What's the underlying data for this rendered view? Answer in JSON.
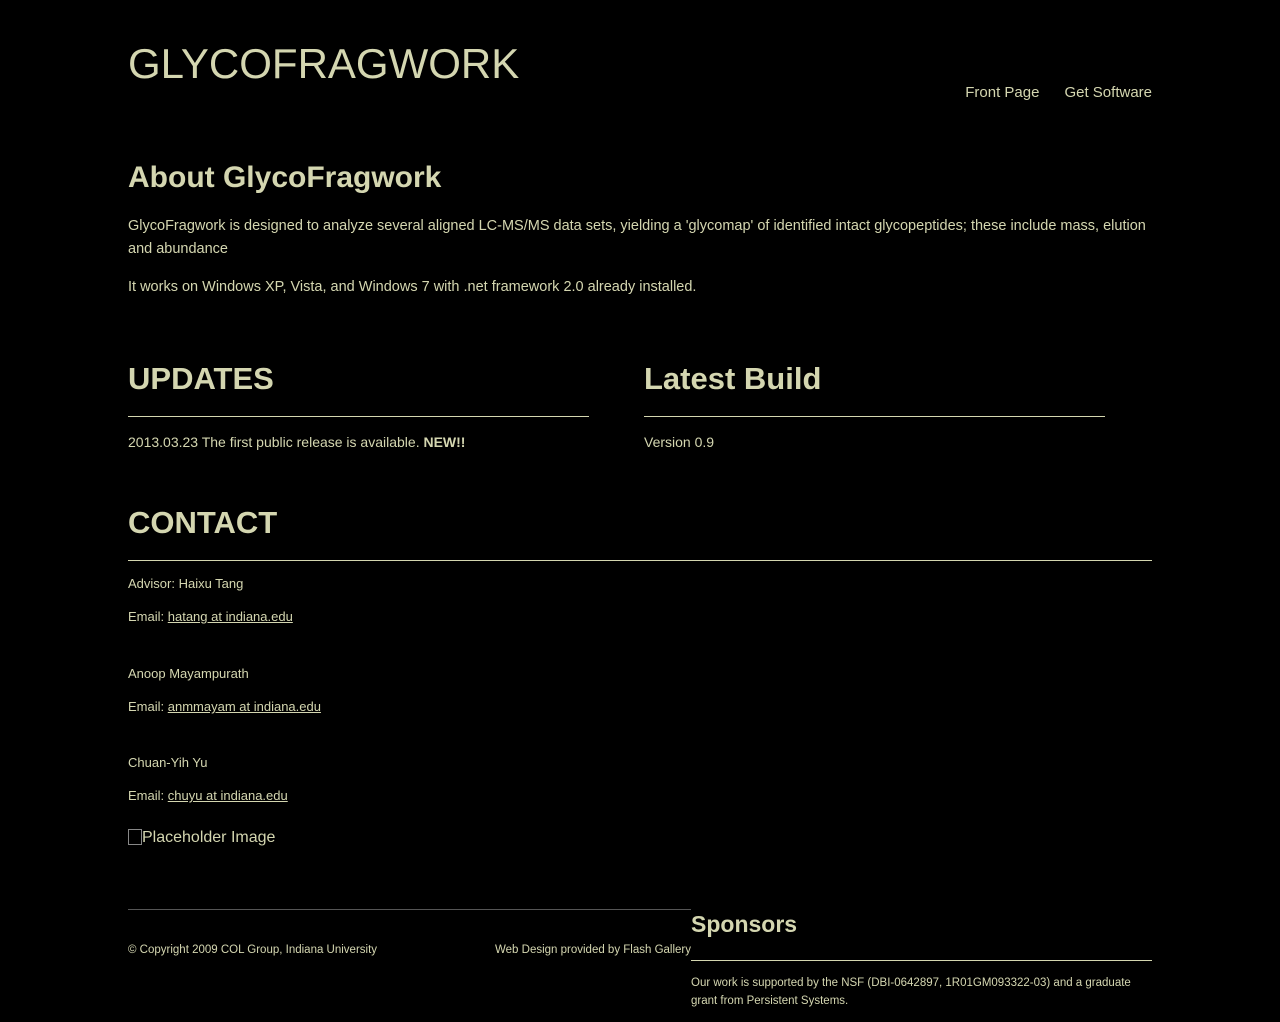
{
  "header": {
    "site_title": "GLYCOFRAGWORK",
    "nav": [
      "Front Page",
      "Get Software"
    ]
  },
  "about": {
    "title": "About GlycoFragwork",
    "paragraph1": "GlycoFragwork is designed to analyze several aligned LC-MS/MS data sets, yielding a 'glycomap' of identified intact glycopeptides; these include mass, elution and abundance",
    "paragraph2": "It works on Windows XP, Vista, and Windows 7 with .net framework 2.0 already installed."
  },
  "updates": {
    "title": "UPDATES",
    "entry_text": "2013.03.23 The first public release is available.",
    "entry_badge": "NEW!!"
  },
  "latest_build": {
    "title": "Latest Build",
    "version": "Version 0.9"
  },
  "contact": {
    "title": "CONTACT",
    "email_label": "Email:",
    "people": [
      {
        "name": "Advisor: Haixu Tang",
        "email": "hatang at indiana.edu"
      },
      {
        "name": "Anoop Mayampurath",
        "email": "anmmayam at indiana.edu"
      },
      {
        "name": "Chuan-Yih Yu",
        "email": "chuyu at indiana.edu"
      }
    ],
    "image_alt": "Placeholder Image"
  },
  "footer": {
    "copyright": "© Copyright 2009 COL Group, Indiana University",
    "credit": "Web Design provided by Flash Gallery"
  },
  "sponsors": {
    "title": "Sponsors",
    "text": "Our work is supported by the NSF (DBI-0642897, 1R01GM093322-03) and a graduate grant from Persistent Systems."
  },
  "colors": {
    "background": "#000000",
    "text": "#d4d6b0"
  }
}
